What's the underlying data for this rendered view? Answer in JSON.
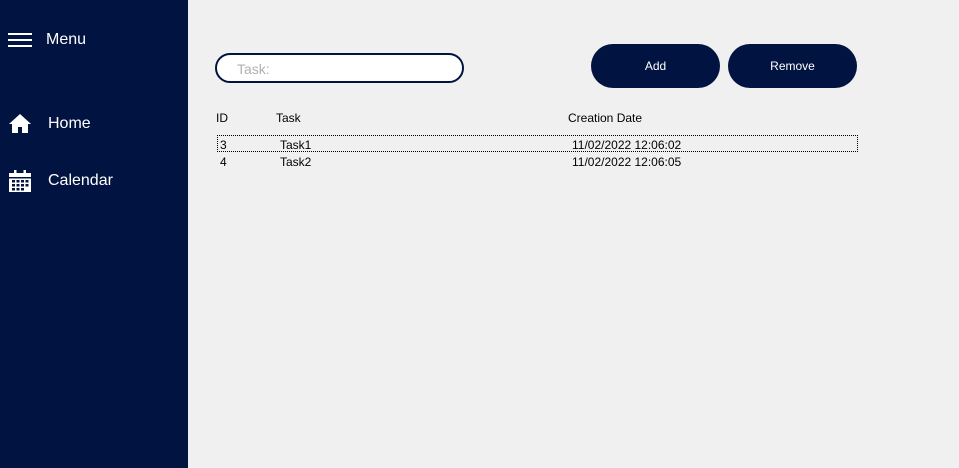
{
  "sidebar": {
    "menu_label": "Menu",
    "items": [
      {
        "label": "Home",
        "icon": "home-icon"
      },
      {
        "label": "Calendar",
        "icon": "calendar-icon"
      }
    ],
    "background": "#011340"
  },
  "form": {
    "task_placeholder": "Task:",
    "task_value": "",
    "add_label": "Add",
    "remove_label": "Remove"
  },
  "table": {
    "columns": [
      "ID",
      "Task",
      "Creation Date"
    ],
    "rows": [
      {
        "id": "3",
        "task": "Task1",
        "date": "11/02/2022 12:06:02"
      },
      {
        "id": "4",
        "task": "Task2",
        "date": "11/02/2022 12:06:05"
      }
    ]
  }
}
